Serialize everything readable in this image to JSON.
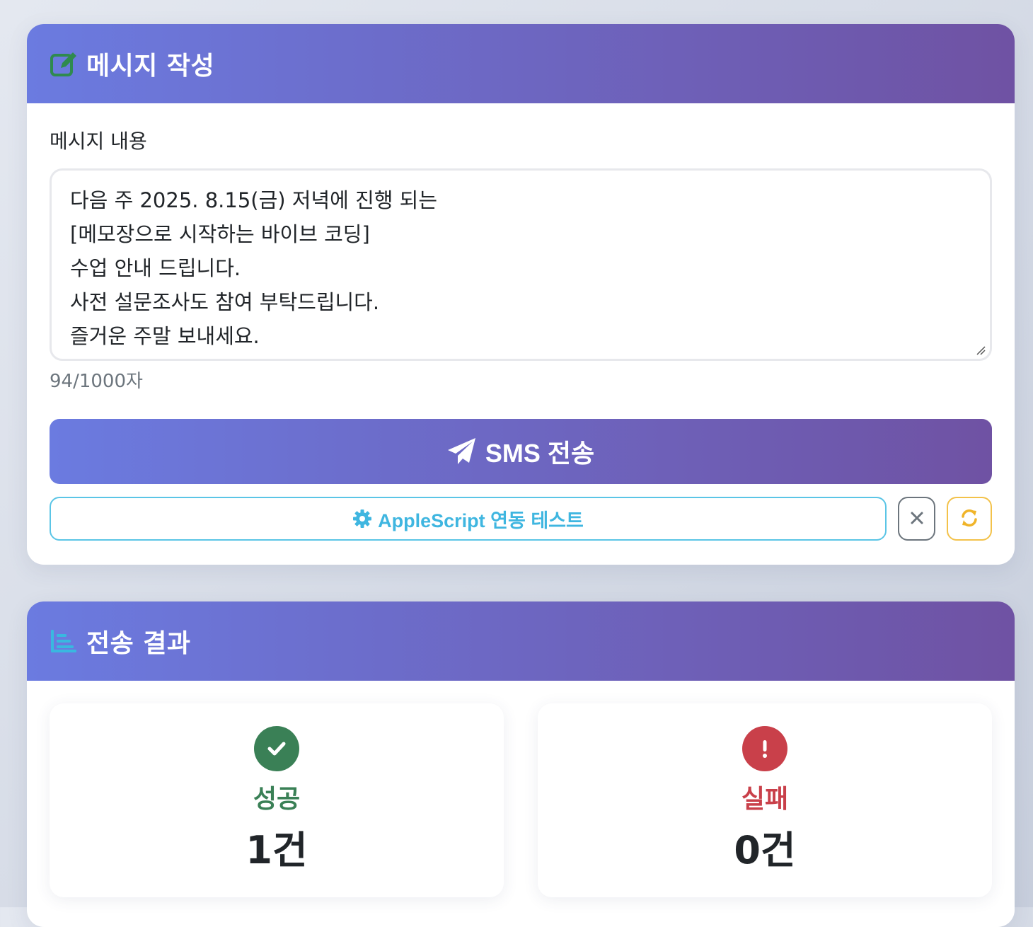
{
  "compose": {
    "title": "메시지 작성",
    "field_label": "메시지 내용",
    "message_lines": [
      "다음 주 2025. 8.15(금) 저녁에 진행 되는",
      "[메모장으로 시작하는 바이브 코딩]",
      "수업 안내 드립니다.",
      "사전 설문조사도 참여 부탁드립니다.",
      "즐거운 주말 보내세요."
    ],
    "char_count": "94/1000자",
    "send_label": "SMS 전송",
    "test_label": "AppleScript 연동 테스트",
    "icons": {
      "header": "edit-icon",
      "send": "paper-plane-icon",
      "test": "gear-icon",
      "clear": "close-icon",
      "refresh": "refresh-icon"
    }
  },
  "results": {
    "title": "전송 결과",
    "header_icon": "list-icon",
    "success": {
      "label": "성공",
      "value": "1건",
      "color": "#3a8056",
      "icon": "check-circle-icon"
    },
    "failure": {
      "label": "실패",
      "value": "0건",
      "color": "#c9404a",
      "icon": "exclamation-circle-icon"
    }
  },
  "colors": {
    "header_gradient_start": "#6b7be0",
    "header_gradient_end": "#6f52a3",
    "info": "#3fb6e0",
    "warning": "#f3c24a",
    "secondary": "#6c757d"
  }
}
